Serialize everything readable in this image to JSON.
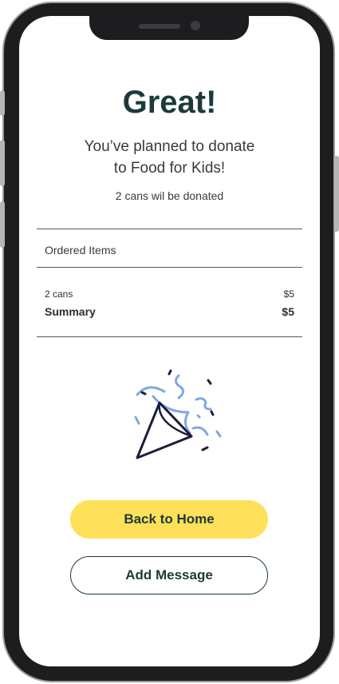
{
  "header": {
    "title": "Great!"
  },
  "message": {
    "line1": "You’ve planned to donate",
    "line2": "to Food for Kids!",
    "note": "2 cans wil be donated"
  },
  "order": {
    "heading": "Ordered Items",
    "item": {
      "label": "2 cans",
      "price": "$5"
    },
    "summary": {
      "label": "Summary",
      "price": "$5"
    }
  },
  "illustration": {
    "icon": "party-popper-icon"
  },
  "actions": {
    "primary_label": "Back to Home",
    "secondary_label": "Add Message"
  },
  "colors": {
    "accent": "#ffe05a",
    "text_dark": "#1c3a3a",
    "confetti_blue": "#7fa8e0"
  }
}
